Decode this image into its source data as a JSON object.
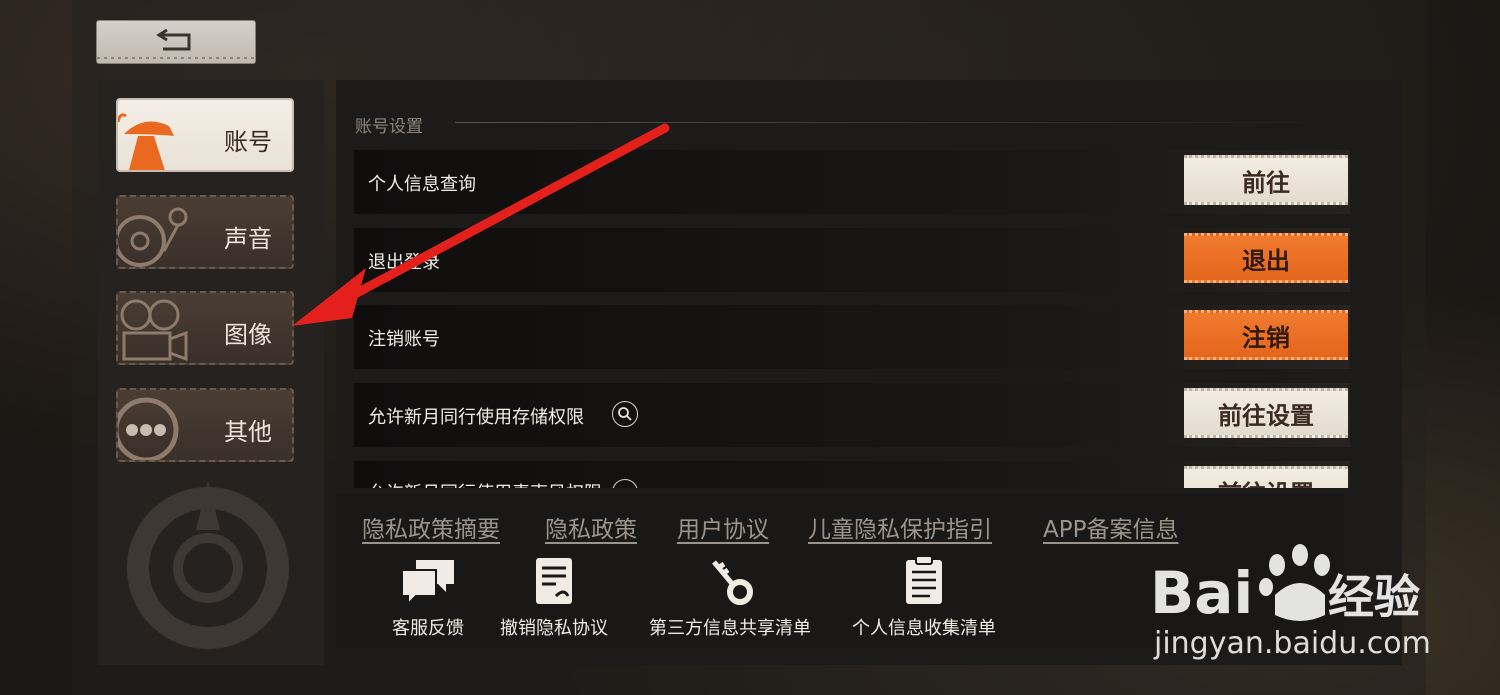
{
  "back_button": {
    "icon": "return-arrow-icon"
  },
  "sidebar": {
    "items": [
      {
        "label": "账号",
        "icon": "detective-hat-icon",
        "active": true
      },
      {
        "label": "声音",
        "icon": "record-player-icon",
        "active": false
      },
      {
        "label": "图像",
        "icon": "film-camera-icon",
        "active": false
      },
      {
        "label": "其他",
        "icon": "more-dots-icon",
        "active": false
      }
    ]
  },
  "section": {
    "title": "账号设置"
  },
  "rows": [
    {
      "label": "个人信息查询",
      "button": "前往",
      "style": "light"
    },
    {
      "label": "退出登录",
      "button": "退出",
      "style": "orange"
    },
    {
      "label": "注销账号",
      "button": "注销",
      "style": "orange"
    },
    {
      "label": "允许新月同行使用存储权限",
      "button": "前往设置",
      "style": "light",
      "has_search_icon": true
    },
    {
      "label": "允许新月同行使用麦克风权限",
      "button": "前往设置",
      "style": "light",
      "has_search_icon": true
    }
  ],
  "footer": {
    "links": [
      "隐私政策摘要",
      "隐私政策",
      "用户协议",
      "儿童隐私保护指引",
      "APP备案信息"
    ],
    "items": [
      {
        "label": "客服反馈",
        "icon": "chat-bubbles-icon"
      },
      {
        "label": "撤销隐私协议",
        "icon": "revoke-document-icon"
      },
      {
        "label": "第三方信息共享清单",
        "icon": "key-icon"
      },
      {
        "label": "个人信息收集清单",
        "icon": "clipboard-icon"
      }
    ]
  },
  "watermark": {
    "brand": "Bai经验",
    "url": "jingyan.baidu.com"
  },
  "colors": {
    "accent": "#e8691f",
    "pill_light": "#efe7dc",
    "annotation_arrow": "#e3201b"
  }
}
